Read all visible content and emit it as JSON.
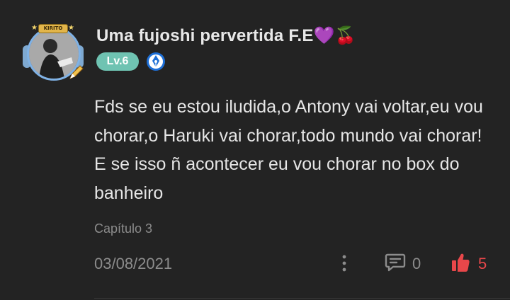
{
  "comment": {
    "author": {
      "name": "Uma fujoshi pervertida F.E",
      "name_emojis": [
        "💜",
        "🍒"
      ],
      "level": "Lv.6",
      "avatar_badge_text": "KIRITO"
    },
    "text": "Fds se eu estou iludida,o Antony vai voltar,eu vou chorar,o Haruki vai chorar,todo mundo vai chorar! E se isso ñ acontecer eu vou chorar no box do banheiro",
    "chapter": "Capítulo 3",
    "date": "03/08/2021",
    "reply_count": "0",
    "like_count": "5",
    "icons": {
      "more": "more-vertical-icon",
      "reply": "reply-bubble-icon",
      "like": "thumbs-up-icon",
      "title_badge": "pen-nib-icon"
    },
    "colors": {
      "background": "#232323",
      "level_badge": "#6fc3b2",
      "like_accent": "#e8474a",
      "muted_text": "#8c8c8c"
    }
  }
}
